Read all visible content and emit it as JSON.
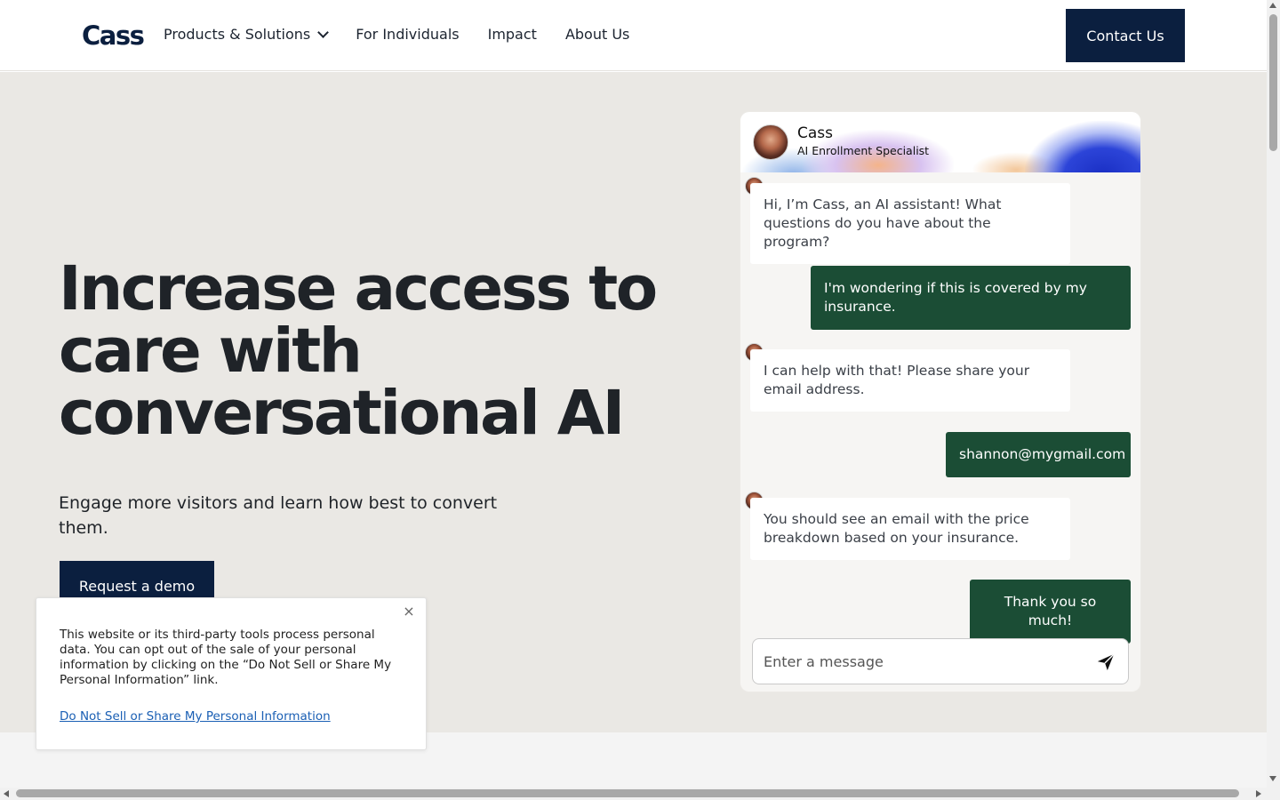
{
  "header": {
    "logo": "Cass",
    "nav": [
      {
        "label": "Products & Solutions",
        "has_dropdown": true
      },
      {
        "label": "For Individuals"
      },
      {
        "label": "Impact"
      },
      {
        "label": "About Us"
      }
    ],
    "contact_label": "Contact Us"
  },
  "hero": {
    "headline": "Increase access to care with conversational AI",
    "subhead": "Engage more visitors and learn how best to convert them.",
    "demo_label": "Request a demo"
  },
  "chat": {
    "agent_name": "Cass",
    "agent_role": "AI Enrollment Specialist",
    "messages": [
      {
        "from": "bot",
        "text": "Hi, I’m Cass, an AI assistant! What questions do you have about the program?"
      },
      {
        "from": "user",
        "text": "I'm wondering if this is covered by my insurance."
      },
      {
        "from": "bot",
        "text": "I can help with that! Please share your email address."
      },
      {
        "from": "user",
        "text": "shannon@mygmail.com"
      },
      {
        "from": "bot",
        "text": "You should see an email with the price breakdown based on your insurance."
      },
      {
        "from": "user",
        "text": "Thank you so much!"
      }
    ],
    "input_placeholder": "Enter a message",
    "send_icon": "send-icon"
  },
  "cookie": {
    "text": "This website or its third-party tools process personal data. You can opt out of the sale of your personal information by clicking on the “Do Not Sell or Share My Personal Information” link.",
    "link_label": "Do Not Sell or Share My Personal Information",
    "close_icon": "close-icon"
  },
  "colors": {
    "brand_navy": "#0b1f3f",
    "chat_user_green": "#1b4d35",
    "hero_bg": "#eae8e4",
    "link_blue": "#1a5fb4"
  }
}
